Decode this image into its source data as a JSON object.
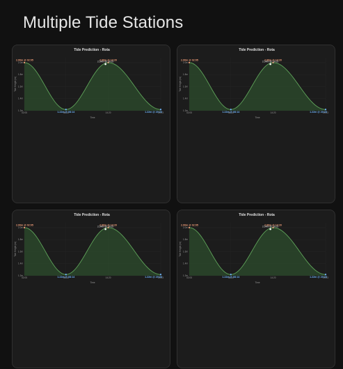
{
  "page": {
    "title": "Multiple Tide Stations"
  },
  "colors": {
    "background": "#111111",
    "card": "#1c1c1c",
    "line": "#5fa35a",
    "fill": "#2c4a2c",
    "high": "#f4a07a",
    "low": "#6fb6ff"
  },
  "cards": [
    {
      "id": "card-1"
    },
    {
      "id": "card-2"
    },
    {
      "id": "card-3"
    },
    {
      "id": "card-4"
    }
  ],
  "chart_data": {
    "type": "area",
    "title": "Tide Prediction - Rota",
    "xlabel": "Time",
    "ylabel": "Tide Height (m)",
    "x_ticks": [
      "02:05",
      "08:14",
      "14:20",
      "20:23"
    ],
    "y_ticks": [
      "1.2m",
      "1.4m",
      "1.6m",
      "1.8m",
      "2.0m"
    ],
    "ylim": [
      1.2,
      2.08
    ],
    "xlim": [
      0,
      1
    ],
    "extremes": [
      {
        "label": "2.00m @ 02:05",
        "kind": "high",
        "x": 0.0,
        "y": 2.0
      },
      {
        "label": "1.22m @ 08:14",
        "kind": "low",
        "x": 0.305,
        "y": 1.22
      },
      {
        "label": "2.00m @ 14:20",
        "kind": "high",
        "x": 0.615,
        "y": 2.0
      },
      {
        "label": "1.22m @ 20:23",
        "kind": "low",
        "x": 1.0,
        "y": 1.22
      }
    ],
    "current": {
      "label": "2.54m @ 14:02",
      "x": 0.595,
      "y": 1.975
    }
  }
}
